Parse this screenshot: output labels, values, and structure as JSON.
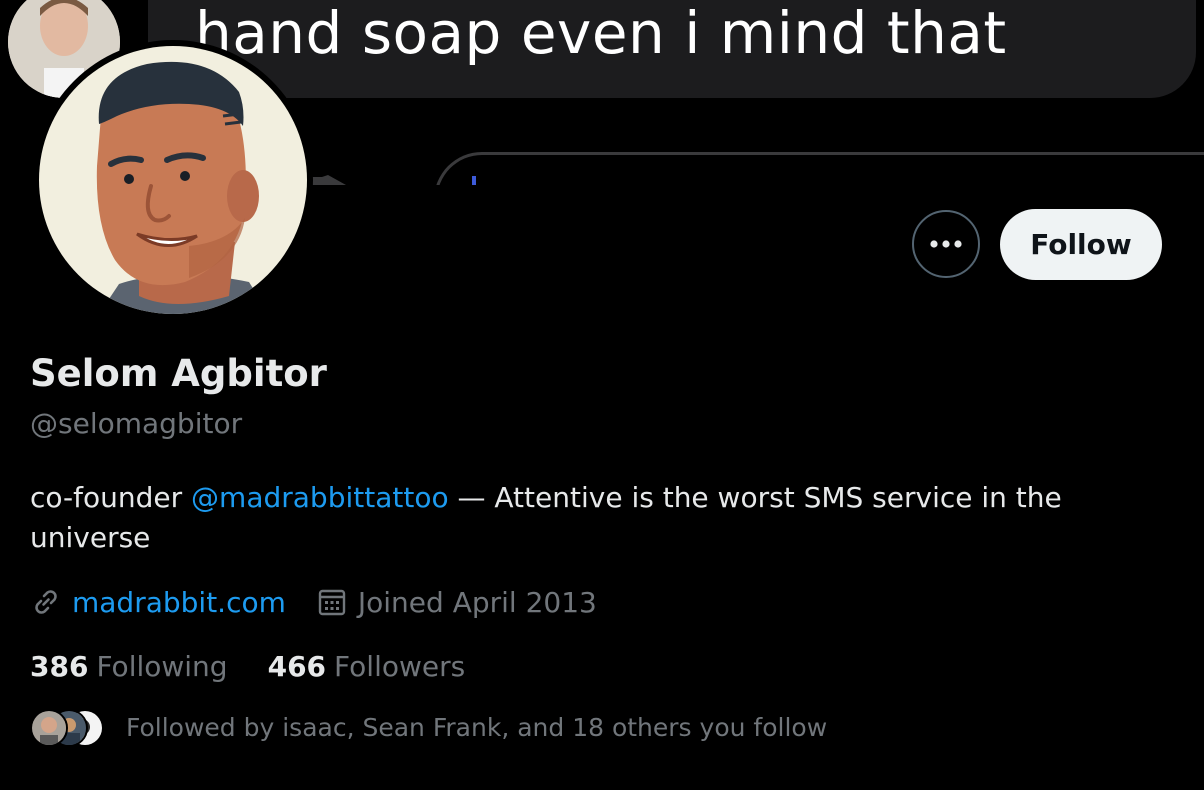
{
  "banner": {
    "message_text": "hand soap even i mind that"
  },
  "profile": {
    "display_name": "Selom Agbitor",
    "handle": "@selomagbitor",
    "bio_prefix": "co-founder ",
    "bio_mention": "@madrabbittattoo",
    "bio_suffix": " — Attentive is the worst SMS service in the universe",
    "website": "madrabbit.com",
    "joined": "Joined April 2013",
    "link_icon": "link-icon",
    "calendar_icon": "calendar-icon"
  },
  "actions": {
    "more_icon": "more-options-icon",
    "follow_label": "Follow"
  },
  "stats": {
    "following_count": "386",
    "following_label": "Following",
    "followers_count": "466",
    "followers_label": "Followers"
  },
  "followed_by": {
    "text": "Followed by isaac, Sean Frank, and 18 others you follow"
  },
  "colors": {
    "background": "#000000",
    "primary_text": "#e7e9ea",
    "secondary_text": "#71767b",
    "link": "#1d9bf0",
    "follow_button_bg": "#eff3f4",
    "avatar_bg": "#f2efdf",
    "avatar_skin": "#c87a55"
  }
}
